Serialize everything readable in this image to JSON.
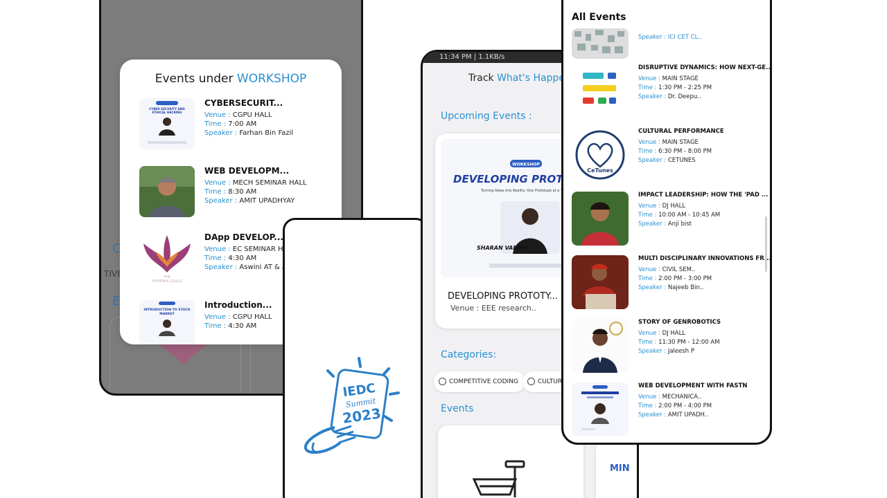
{
  "workshop": {
    "title_prefix": "Events under ",
    "title_accent": "WORKSHOP",
    "bg_fragments": [
      "C",
      "TIVE",
      "E"
    ],
    "events": [
      {
        "title": "CYBERSECURIT...",
        "venue": "CGPU HALL",
        "time": "7:00 AM",
        "speaker": "Farhan Bin Fazil",
        "poster": "CYBER SECURITY AND ETHICAL HACKING"
      },
      {
        "title": "WEB DEVELOPM...",
        "venue": "MECH SEMINAR HALL",
        "time": "8:30 AM",
        "speaker": "AMIT UPADHYAY"
      },
      {
        "title": "DApp DEVELOP...",
        "venue": "EC SEMINAR HA",
        "time": "4:30 AM",
        "speaker": "Aswini AT & As",
        "poster": "THE PHOENIX GUILD"
      },
      {
        "title": "Introduction...",
        "venue": "CGPU HALL",
        "time": "4:30 AM",
        "speaker": "",
        "poster": "INTRODUCTION TO STOCK MARKET"
      }
    ],
    "labels": {
      "venue": "Venue : ",
      "time": "Time : ",
      "speaker": "Speaker : "
    }
  },
  "logo": {
    "line1": "IEDC",
    "line2": "Summit",
    "line3": "2023"
  },
  "home": {
    "status": "11:34 PM | 1.1KB/s",
    "title_prefix": "Track ",
    "title_accent": "What's Happe",
    "upcoming_label": "Upcoming Events :",
    "upcoming": {
      "badge": "WORKSHOP",
      "poster_title": "DEVELOPING PROTOTYPES/",
      "poster_sub": "Turning Ideas into Reality: One Prototype at a Time",
      "speaker": "SHARAN VARMA",
      "name": "DEVELOPING PROTOTY...",
      "venue": "Venue : EEE research.."
    },
    "categories_label": "Categories:",
    "categories": [
      "COMPETITIVE CODING",
      "CULTURA"
    ],
    "events_label": "Events",
    "side_card_text": "MIN"
  },
  "all_events": {
    "title": "All Events",
    "labels": {
      "venue": "Venue : ",
      "time": "Time : ",
      "speaker": "Speaker : "
    },
    "top_speaker": "Speaker : ICI CET CL..",
    "items": [
      {
        "title": "DISRUPTIVE DYNAMICS: HOW NEXT-GE...",
        "venue": "MAIN STAGE",
        "time": "1:30 PM - 2:25 PM",
        "speaker": "Dr. Deepu.."
      },
      {
        "title": "CULTURAL PERFORMANCE",
        "venue": "MAIN STAGE",
        "time": "6:30 PM - 8:00 PM",
        "speaker": "CETUNES",
        "logo_text": "CeTunes"
      },
      {
        "title": "IMPACT LEADERSHIP: HOW THE 'PAD ...",
        "venue": "DJ HALL",
        "time": "10:00 AM - 10:45 AM",
        "speaker": "Anji bist"
      },
      {
        "title": "MULTI DISCIPLINARY INNOVATIONS FR...",
        "venue": "CIVIL SEM..",
        "time": "2:00 PM - 3:00 PM",
        "speaker": "Najeeb Bin.."
      },
      {
        "title": "STORY OF GENROBOTICS",
        "venue": "DJ HALL",
        "time": "11:30 PM - 12:00 AM",
        "speaker": "Jaleesh P"
      },
      {
        "title": "WEB DEVELOPMENT WITH FASTN",
        "venue": "MECHANICA..",
        "time": "2:00 PM - 4:00 PM",
        "speaker": "AMIT UPADH.."
      }
    ]
  },
  "colors": {
    "accent": "#2a8fd0",
    "overlay": "#7c7c7c",
    "logo_blue": "#2b7fc8"
  }
}
